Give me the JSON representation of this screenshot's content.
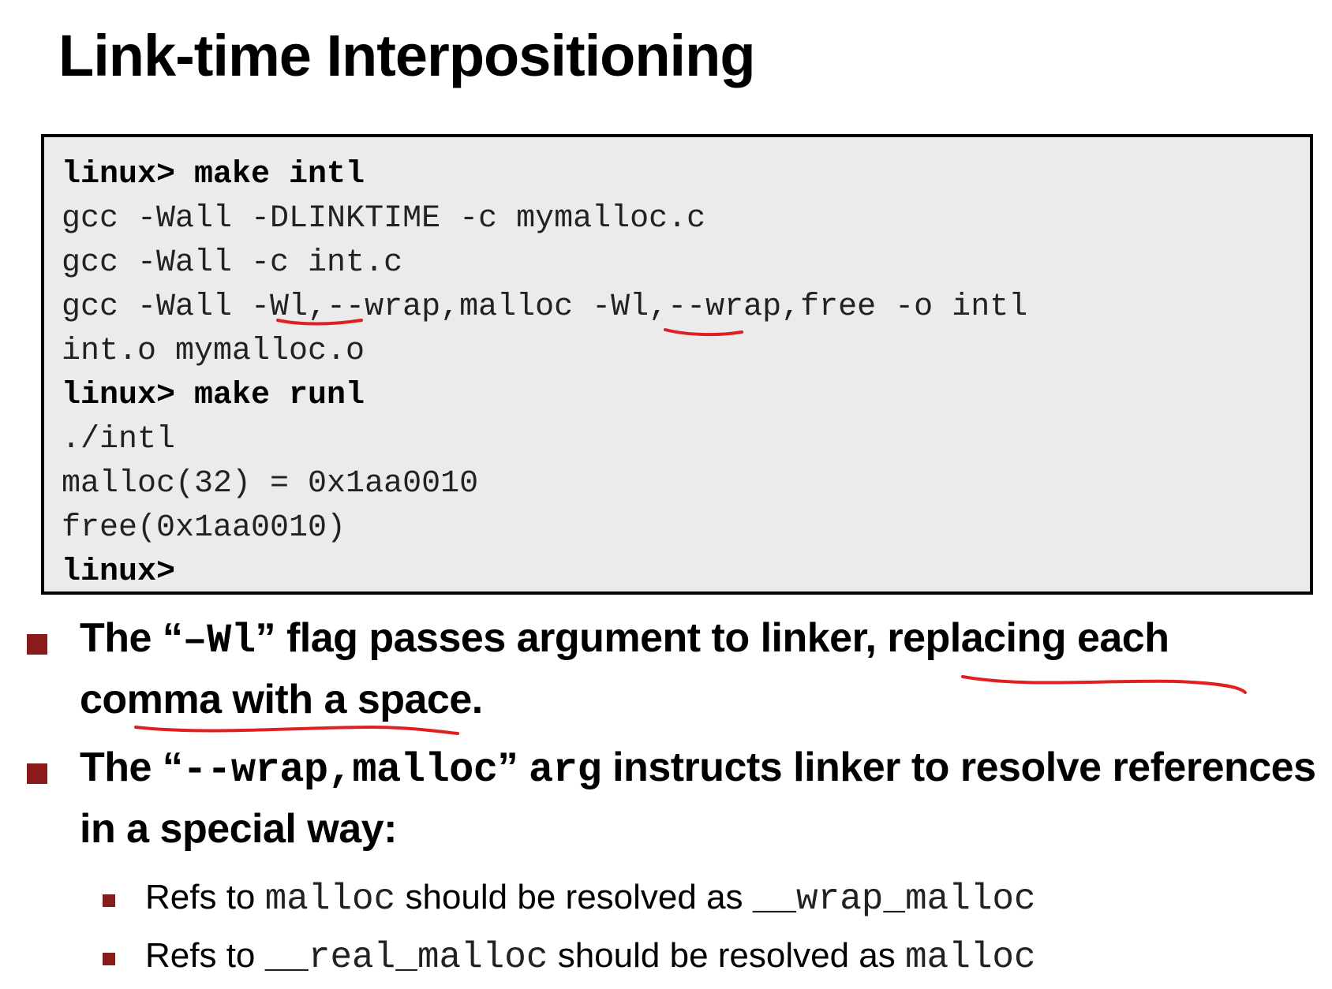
{
  "slide": {
    "title": "Link-time Interpositioning"
  },
  "terminal": {
    "lines": [
      "linux> make intl",
      "gcc -Wall -DLINKTIME -c mymalloc.c",
      "gcc -Wall -c int.c",
      "gcc -Wall -Wl,--wrap,malloc -Wl,--wrap,free -o intl",
      "int.o mymalloc.o",
      "linux> make runl",
      "./intl",
      "malloc(32) = 0x1aa0010",
      "free(0x1aa0010)",
      "linux>"
    ]
  },
  "bullets": {
    "b1": {
      "t1": "The “",
      "code": "–Wl",
      "t2": "” flag passes argument to linker, replacing each comma with a space."
    },
    "b2": {
      "t1": "The “",
      "code": "--wrap,malloc",
      "t2": "” ",
      "code2": "arg",
      "t3": " instructs linker to resolve references in a special way:"
    },
    "sub1": {
      "t1": "Refs to ",
      "code1": "malloc",
      "t2": " should be resolved as ",
      "code2": "__wrap_malloc"
    },
    "sub2": {
      "t1": "Refs to ",
      "code1": "__real_malloc",
      "t2": " should be resolved as ",
      "code2": "malloc"
    }
  },
  "colors": {
    "bullet_marker": "#8b1a1a",
    "annotation_ink": "#e02020",
    "terminal_bg": "#ebebeb"
  }
}
